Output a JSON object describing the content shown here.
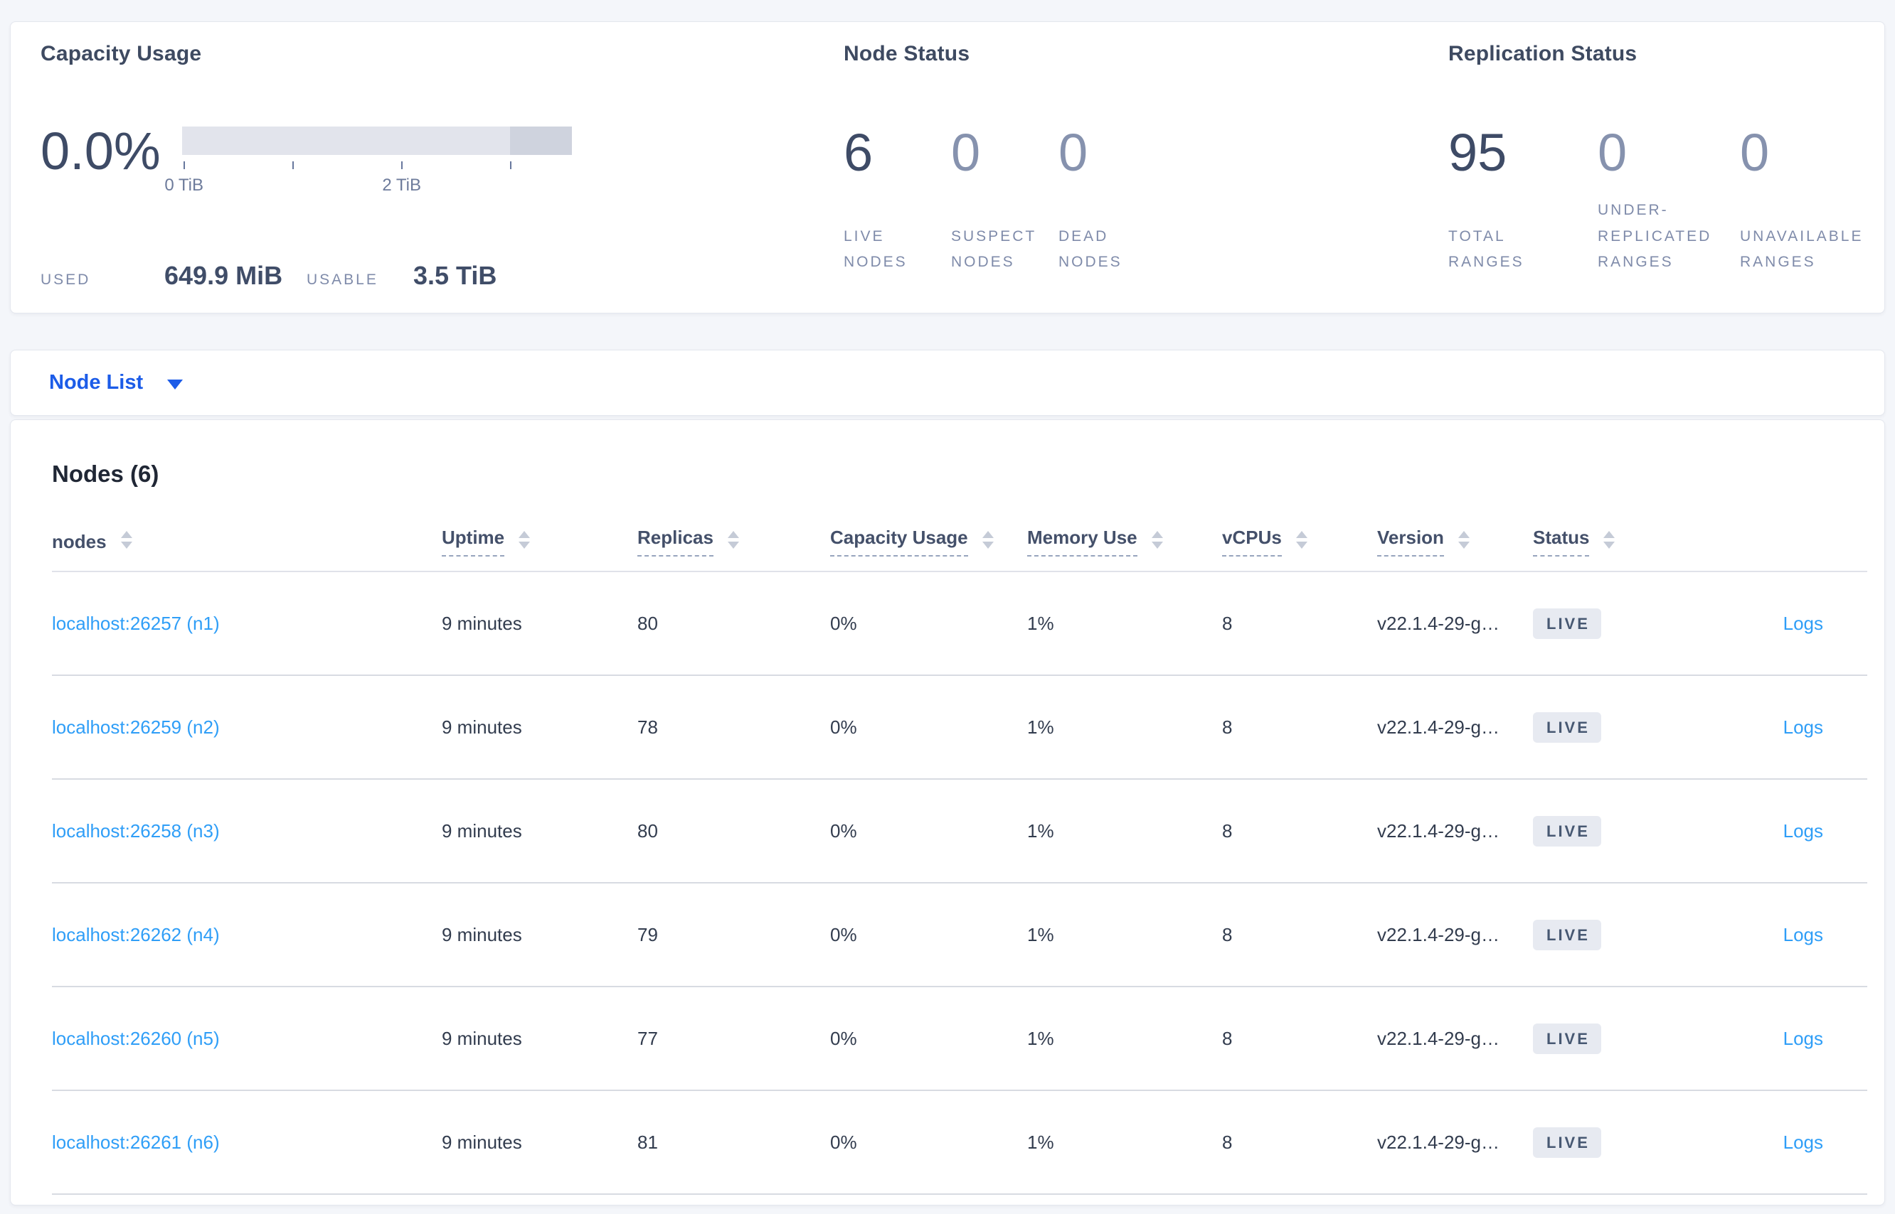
{
  "overview": {
    "capacity": {
      "title": "Capacity Usage",
      "percent": "0.0%",
      "axis_ticks": [
        {
          "label": "0 TiB"
        },
        {
          "label": ""
        },
        {
          "label": "2 TiB"
        },
        {
          "label": ""
        }
      ],
      "used_label": "USED",
      "used_value": "649.9 MiB",
      "usable_label": "USABLE",
      "usable_value": "3.5 TiB"
    },
    "node_status": {
      "title": "Node Status",
      "metrics": [
        {
          "value": "6",
          "label": "LIVE NODES"
        },
        {
          "value": "0",
          "label": "SUSPECT NODES"
        },
        {
          "value": "0",
          "label": "DEAD NODES"
        }
      ]
    },
    "replication_status": {
      "title": "Replication Status",
      "metrics": [
        {
          "value": "95",
          "label": "TOTAL RANGES"
        },
        {
          "value": "0",
          "label": "UNDER-REPLICATED RANGES"
        },
        {
          "value": "0",
          "label": "UNAVAILABLE RANGES"
        }
      ]
    }
  },
  "view_selector": {
    "label": "Node List"
  },
  "nodes_section": {
    "title": "Nodes (6)",
    "table": {
      "columns": [
        {
          "label": "nodes"
        },
        {
          "label": "Uptime"
        },
        {
          "label": "Replicas"
        },
        {
          "label": "Capacity Usage"
        },
        {
          "label": "Memory Use"
        },
        {
          "label": "vCPUs"
        },
        {
          "label": "Version"
        },
        {
          "label": "Status"
        },
        {
          "label": ""
        }
      ],
      "rows": [
        {
          "node": "localhost:26257 (n1)",
          "uptime": "9 minutes",
          "replicas": "80",
          "capacity": "0%",
          "memory": "1%",
          "vcpus": "8",
          "version": "v22.1.4-29-g…",
          "status": "LIVE",
          "logs": "Logs"
        },
        {
          "node": "localhost:26259 (n2)",
          "uptime": "9 minutes",
          "replicas": "78",
          "capacity": "0%",
          "memory": "1%",
          "vcpus": "8",
          "version": "v22.1.4-29-g…",
          "status": "LIVE",
          "logs": "Logs"
        },
        {
          "node": "localhost:26258 (n3)",
          "uptime": "9 minutes",
          "replicas": "80",
          "capacity": "0%",
          "memory": "1%",
          "vcpus": "8",
          "version": "v22.1.4-29-g…",
          "status": "LIVE",
          "logs": "Logs"
        },
        {
          "node": "localhost:26262 (n4)",
          "uptime": "9 minutes",
          "replicas": "79",
          "capacity": "0%",
          "memory": "1%",
          "vcpus": "8",
          "version": "v22.1.4-29-g…",
          "status": "LIVE",
          "logs": "Logs"
        },
        {
          "node": "localhost:26260 (n5)",
          "uptime": "9 minutes",
          "replicas": "77",
          "capacity": "0%",
          "memory": "1%",
          "vcpus": "8",
          "version": "v22.1.4-29-g…",
          "status": "LIVE",
          "logs": "Logs"
        },
        {
          "node": "localhost:26261 (n6)",
          "uptime": "9 minutes",
          "replicas": "81",
          "capacity": "0%",
          "memory": "1%",
          "vcpus": "8",
          "version": "v22.1.4-29-g…",
          "status": "LIVE",
          "logs": "Logs"
        }
      ]
    }
  },
  "colors": {
    "accent_blue": "#1c5ce8",
    "link_blue": "#2f9ef7",
    "dark_text": "#3e4b66",
    "muted_text": "#7f8baa",
    "bar_light": "#e2e4ec",
    "bar_dark": "#cfd3de",
    "badge_bg": "#e7eaf1"
  }
}
